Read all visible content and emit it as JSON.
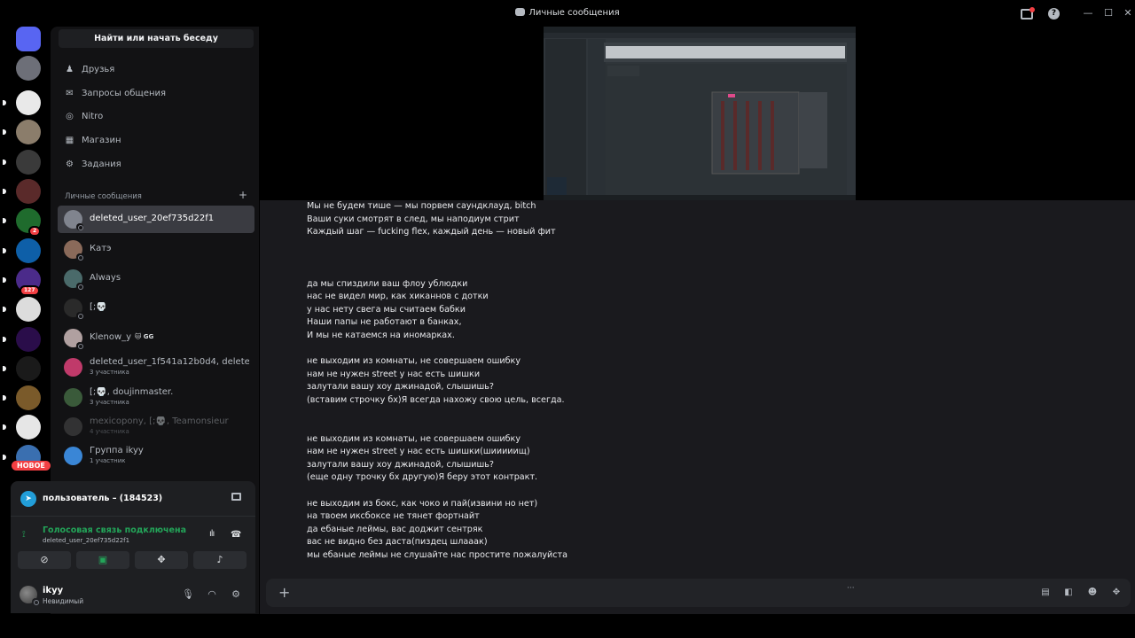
{
  "window": {
    "title": "Личные сообщения",
    "controls": {
      "minimize": "—",
      "maximize": "☐",
      "close": "✕"
    }
  },
  "rail": {
    "servers": [
      {
        "name": "discord-home",
        "color": "#5865f2"
      },
      {
        "name": "server-2",
        "color": "#6d6f78"
      },
      {
        "name": "server-3",
        "color": "#e9e9e9"
      },
      {
        "name": "server-4",
        "color": "#8b7d6b"
      },
      {
        "name": "server-5",
        "color": "#3a3a3a"
      },
      {
        "name": "server-6",
        "color": "#5a2a2a"
      },
      {
        "name": "server-7",
        "color": "#1f6b2d",
        "badge": "2"
      },
      {
        "name": "server-8",
        "color": "#0e5fa8"
      },
      {
        "name": "server-9",
        "color": "#4b2b8a",
        "badge": "127"
      },
      {
        "name": "server-10",
        "color": "#dcdcdc"
      },
      {
        "name": "server-11",
        "color": "#2a0d4a"
      },
      {
        "name": "server-12",
        "color": "#1a1a1a"
      },
      {
        "name": "server-13",
        "color": "#7a5a2a"
      },
      {
        "name": "server-14",
        "color": "#e6e6e6"
      },
      {
        "name": "server-15",
        "color": "#3a6fb0"
      }
    ],
    "new_label": "НОВОЕ"
  },
  "sidebar": {
    "search_label": "Найти или начать беседу",
    "nav": [
      {
        "label": "Друзья",
        "icon": "friends-icon"
      },
      {
        "label": "Запросы общения",
        "icon": "mail-icon"
      },
      {
        "label": "Nitro",
        "icon": "nitro-icon"
      },
      {
        "label": "Магазин",
        "icon": "shop-icon"
      },
      {
        "label": "Задания",
        "icon": "quests-icon"
      }
    ],
    "dm_header": "Личные сообщения",
    "dm_add": "+",
    "dms": [
      {
        "name": "deleted_user_20ef735d22f1",
        "sub": "",
        "color": "#80848e",
        "active": true
      },
      {
        "name": "Катэ",
        "sub": "",
        "color": "#8a6a5a"
      },
      {
        "name": "Always",
        "sub": "",
        "color": "#4a6a6a"
      },
      {
        "name": "[;💀",
        "sub": "",
        "color": "#2a2a2a"
      },
      {
        "name": "Klenow_y",
        "tag": "🐱 GG",
        "sub": "",
        "color": "#b0a0a0"
      },
      {
        "name": "deleted_user_1f541a12b0d4, deleted...",
        "sub": "3 участника",
        "color": "#c03a6a"
      },
      {
        "name": "[;💀, doujinmaster.",
        "sub": "3 участника",
        "color": "#3a5a3a"
      },
      {
        "name": "mexicopony, [;💀, Teamonsieur",
        "sub": "4 участника",
        "color": "#5a5a5a",
        "dim": true
      },
      {
        "name": "Группа ikyy",
        "sub": "1 участник",
        "color": "#3a86d6"
      }
    ],
    "cut_item": "Группа ikyy"
  },
  "voice": {
    "stream_user": "пользователь – (184523)",
    "status": "Голосовая связь подключена",
    "channel": "deleted_user_20ef735d22f1"
  },
  "user": {
    "name": "ikyy",
    "status": "Невидимый"
  },
  "messages": [
    "Мы не будем тише — мы порвем саундклауд, bitch",
    "Ваши суки смотрят в след, мы наподиум стрит",
    "Каждый шаг — fucking flex, каждый день — новый фит",
    "",
    "",
    "",
    "да мы спиздили ваш флоу ублюдки",
    "нас не видел мир, как хиканнов с дотки",
    "у нас нету свега мы считаем бабки",
    "Наши папы не работают в банках,",
    "И мы не катаемся на иномарках.",
    "",
    "не выходим из комнаты, не совершаем ошибку",
    "нам не нужен street у нас есть шишки",
    "залутали вашу хоу джинадой, слышишь?",
    "(вставим строчку бх)Я всегда нахожу свою цель, всегда.",
    "",
    "",
    "не выходим из комнаты, не совершаем ошибку",
    "нам не нужен street у нас есть шишки(шииииищ)",
    "залутали вашу хоу джинадой, слышишь?",
    "(еще одну трочку бх другую)Я беру этот контракт.",
    "",
    "не выходим из бокс, как чоко и пай(извини но нет)",
    "на твоем иксбоксе не тянет фортнайт",
    "да ебаные леймы, вас доджит сентряк",
    "вас не видно без даста(пиздец шлааак)",
    "мы ебаные леймы не слушайте нас простите пожалуйста"
  ],
  "composer": {
    "add": "+",
    "typing": "···"
  }
}
